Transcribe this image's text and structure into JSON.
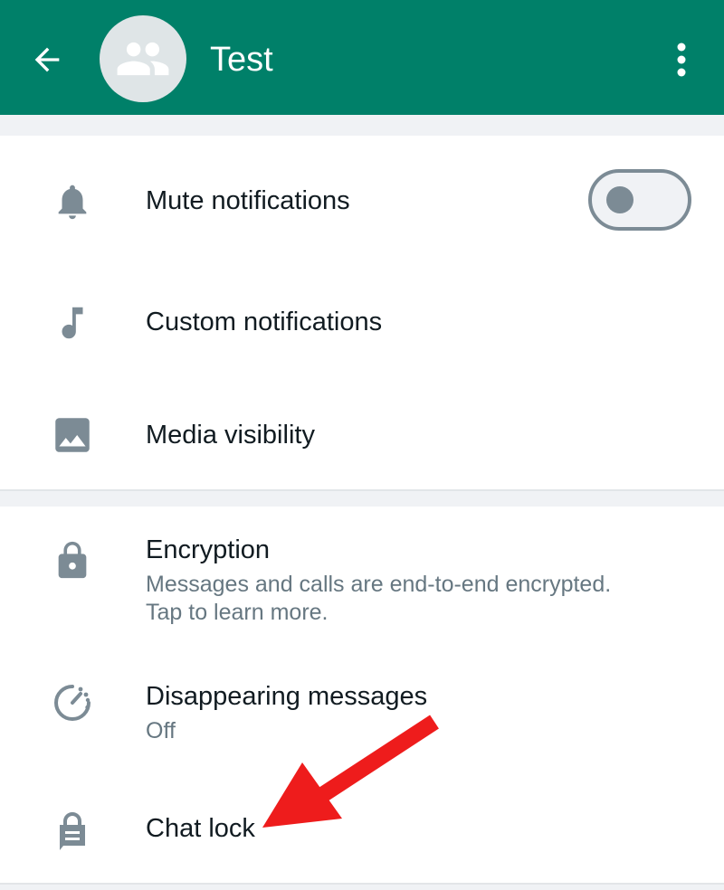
{
  "header": {
    "title": "Test",
    "back_icon": "arrow-back-icon",
    "avatar_icon": "group-icon",
    "menu_icon": "more-vert-icon",
    "background_color": "#008069"
  },
  "notifications_section": {
    "items": [
      {
        "label": "Mute notifications",
        "icon": "bell-icon",
        "toggle": {
          "on": false
        }
      },
      {
        "label": "Custom notifications",
        "icon": "music-note-icon"
      },
      {
        "label": "Media visibility",
        "icon": "image-icon"
      }
    ]
  },
  "privacy_section": {
    "items": [
      {
        "label": "Encryption",
        "icon": "lock-icon",
        "subtitle_line1": "Messages and calls are end-to-end encrypted.",
        "subtitle_line2": "Tap to learn more."
      },
      {
        "label": "Disappearing messages",
        "icon": "timer-icon",
        "subtitle": "Off"
      },
      {
        "label": "Chat lock",
        "icon": "chat-lock-icon"
      }
    ]
  },
  "annotation": {
    "type": "red-arrow",
    "points_to": "Chat lock",
    "color": "#ee1c1c"
  }
}
